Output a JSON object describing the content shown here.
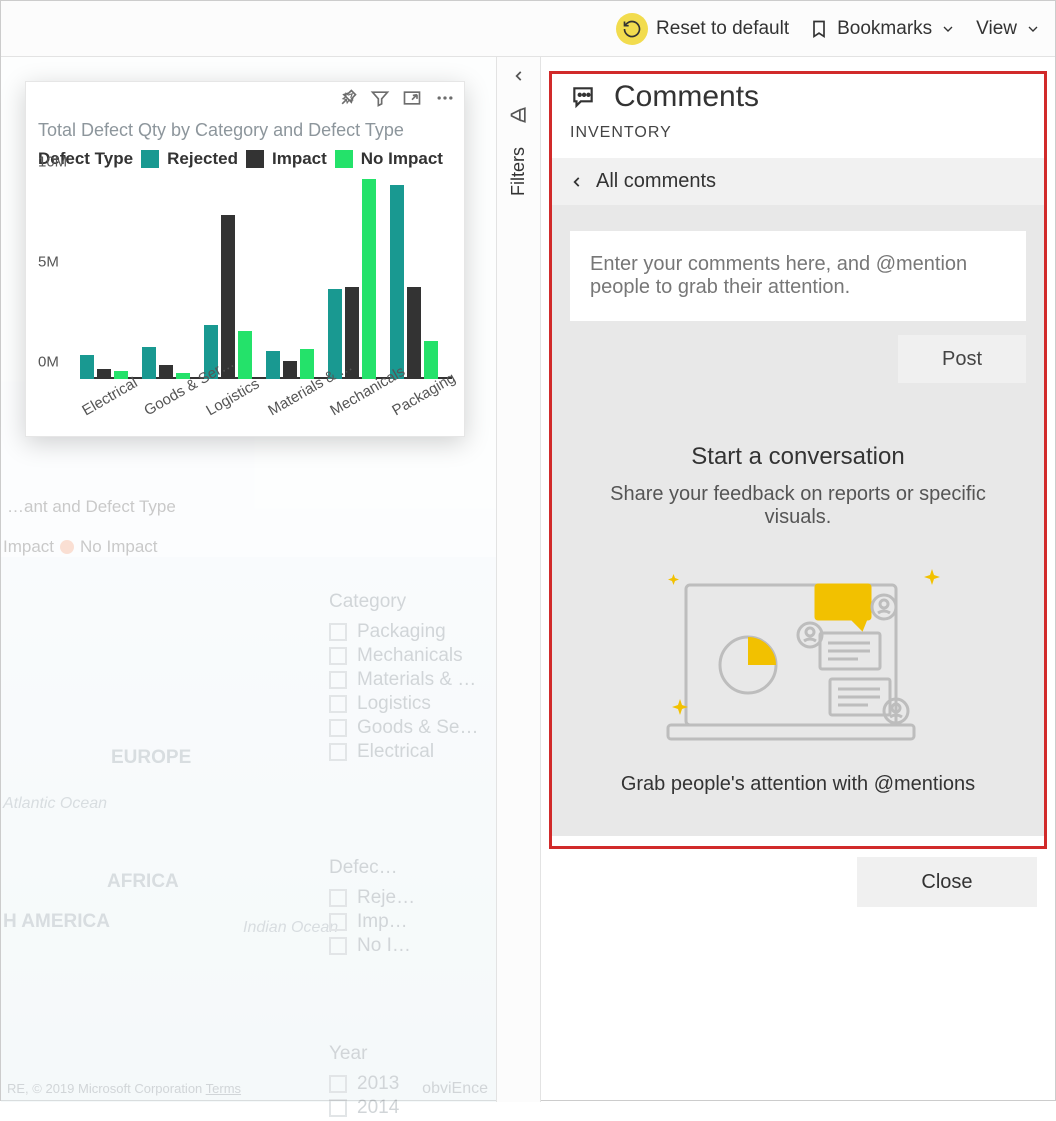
{
  "toolbar": {
    "reset_label": "Reset to default",
    "bookmarks_label": "Bookmarks",
    "view_label": "View"
  },
  "filters_rail": {
    "label": "Filters"
  },
  "chart": {
    "title": "Total Defect Qty by Category and Defect Type",
    "legend_title": "Defect Type",
    "series_names": {
      "rejected": "Rejected",
      "impact": "Impact",
      "no_impact": "No Impact"
    },
    "colors": {
      "rejected": "#199991",
      "impact": "#333333",
      "no_impact": "#24e26a"
    }
  },
  "chart_data": {
    "type": "bar",
    "title": "Total Defect Qty by Category and Defect Type",
    "xlabel": "",
    "ylabel": "",
    "ylim": [
      0,
      10000000
    ],
    "yticks": [
      "0M",
      "5M",
      "10M"
    ],
    "categories": [
      "Electrical",
      "Goods & Ser…",
      "Logistics",
      "Materials & …",
      "Mechanicals",
      "Packaging"
    ],
    "series": [
      {
        "name": "Rejected",
        "color": "#199991",
        "values": [
          1200000,
          1600000,
          2700000,
          1400000,
          4500000,
          9700000
        ]
      },
      {
        "name": "Impact",
        "color": "#333333",
        "values": [
          500000,
          700000,
          8200000,
          900000,
          4600000,
          4600000
        ]
      },
      {
        "name": "No Impact",
        "color": "#24e26a",
        "values": [
          400000,
          300000,
          2400000,
          1500000,
          10000000,
          1900000
        ]
      }
    ]
  },
  "backdrop": {
    "title_fragment": "…ant and Defect Type",
    "legend": {
      "impact": "Impact",
      "no_impact": "No Impact"
    },
    "slicers": {
      "category": {
        "title": "Category",
        "items": [
          "Packaging",
          "Mechanicals",
          "Materials & …",
          "Logistics",
          "Goods & Se…",
          "Electrical"
        ]
      },
      "defect": {
        "title": "Defec…",
        "items": [
          "Reje…",
          "Imp…",
          "No I…"
        ]
      },
      "year": {
        "title": "Year",
        "items": [
          "2013",
          "2014"
        ]
      }
    },
    "map_labels": [
      "EUROPE",
      "AFRICA",
      "Atlantic Ocean",
      "Indian Ocean",
      "H AMERICA"
    ],
    "credit_prefix": "RE, © 2019 Microsoft Corporation ",
    "credit_link": "Terms",
    "obvience": "obviEnce"
  },
  "comments": {
    "title": "Comments",
    "subhead": "INVENTORY",
    "back_label": "All comments",
    "compose_placeholder": "Enter your comments here, and @mention people to grab their attention.",
    "post_label": "Post",
    "empty_title": "Start a conversation",
    "empty_body": "Share your feedback on reports or specific visuals.",
    "tagline": "Grab people's attention with @mentions",
    "close_label": "Close"
  }
}
